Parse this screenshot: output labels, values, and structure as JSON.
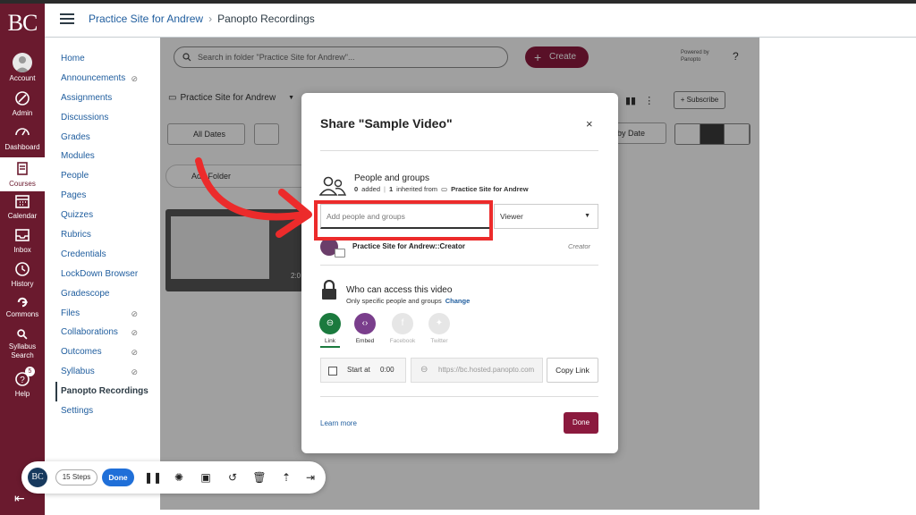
{
  "global_nav": {
    "logo": "BC",
    "items": [
      {
        "label": "Account",
        "icon": "account-icon"
      },
      {
        "label": "Admin",
        "icon": "admin-icon"
      },
      {
        "label": "Dashboard",
        "icon": "dashboard-icon"
      },
      {
        "label": "Courses",
        "icon": "courses-icon"
      },
      {
        "label": "Calendar",
        "icon": "calendar-icon"
      },
      {
        "label": "Inbox",
        "icon": "inbox-icon"
      },
      {
        "label": "History",
        "icon": "history-icon"
      },
      {
        "label": "Commons",
        "icon": "commons-icon"
      },
      {
        "label": "Syllabus Search",
        "icon": "search-icon"
      },
      {
        "label": "Help",
        "icon": "help-icon"
      }
    ],
    "help_badge": "5",
    "collapse_icon": "collapse-nav-icon"
  },
  "breadcrumb": {
    "course": "Practice Site for Andrew",
    "page": "Panopto Recordings"
  },
  "course_nav": {
    "items": [
      {
        "label": "Home"
      },
      {
        "label": "Announcements",
        "hidden": true
      },
      {
        "label": "Assignments"
      },
      {
        "label": "Discussions"
      },
      {
        "label": "Grades"
      },
      {
        "label": "Modules"
      },
      {
        "label": "People"
      },
      {
        "label": "Pages"
      },
      {
        "label": "Quizzes"
      },
      {
        "label": "Rubrics"
      },
      {
        "label": "Credentials"
      },
      {
        "label": "LockDown Browser"
      },
      {
        "label": "Gradescope"
      },
      {
        "label": "Files",
        "hidden": true
      },
      {
        "label": "Collaborations",
        "hidden": true
      },
      {
        "label": "Outcomes",
        "hidden": true
      },
      {
        "label": "Syllabus",
        "hidden": true
      },
      {
        "label": "Panopto Recordings",
        "active": true
      },
      {
        "label": "Settings"
      }
    ]
  },
  "panopto": {
    "search_placeholder": "Search in folder \"Practice Site for Andrew\"...",
    "create_label": "Create",
    "powered_by_line1": "Powered by",
    "powered_by_line2": "Panopto",
    "help": "?",
    "folder_name": "Practice Site for Andrew",
    "all_dates": "All Dates",
    "add_folder": "Add Folder",
    "subscribe": "+ Subscribe",
    "sort_label": "by Date",
    "thumb_duration": "2:0"
  },
  "modal": {
    "title": "Share \"Sample Video\"",
    "close": "×",
    "people_title": "People and groups",
    "added_count": "0",
    "added_text": "added",
    "inherited_count": "1",
    "inherited_text": "inherited from",
    "inherited_source": "Practice Site for Andrew",
    "add_placeholder": "Add people and groups",
    "role_select": "Viewer",
    "member_name": "Practice Site for Andrew::Creator",
    "member_role": "Creator",
    "access_title": "Who can access this video",
    "access_sub": "Only specific people and groups",
    "change_link": "Change",
    "share_options": [
      {
        "label": "Link",
        "color": "#1b7a3e",
        "enabled": true
      },
      {
        "label": "Embed",
        "color": "#7a3e8c",
        "enabled": true
      },
      {
        "label": "Facebook",
        "color": "#e2e2e2",
        "enabled": false
      },
      {
        "label": "Twitter",
        "color": "#e2e2e2",
        "enabled": false
      }
    ],
    "start_at_label": "Start at",
    "start_at_time": "0:00",
    "url": "https://bc.hosted.panopto.com",
    "copy_link": "Copy Link",
    "learn_more": "Learn more",
    "done": "Done"
  },
  "recorder": {
    "logo": "BC",
    "steps": "15 Steps",
    "done": "Done"
  },
  "colors": {
    "canvas_nav": "#6a1a2e",
    "panopto_accent": "#8b1a3e",
    "annotation": "#ec2b2b",
    "link": "#1f5d9e"
  }
}
